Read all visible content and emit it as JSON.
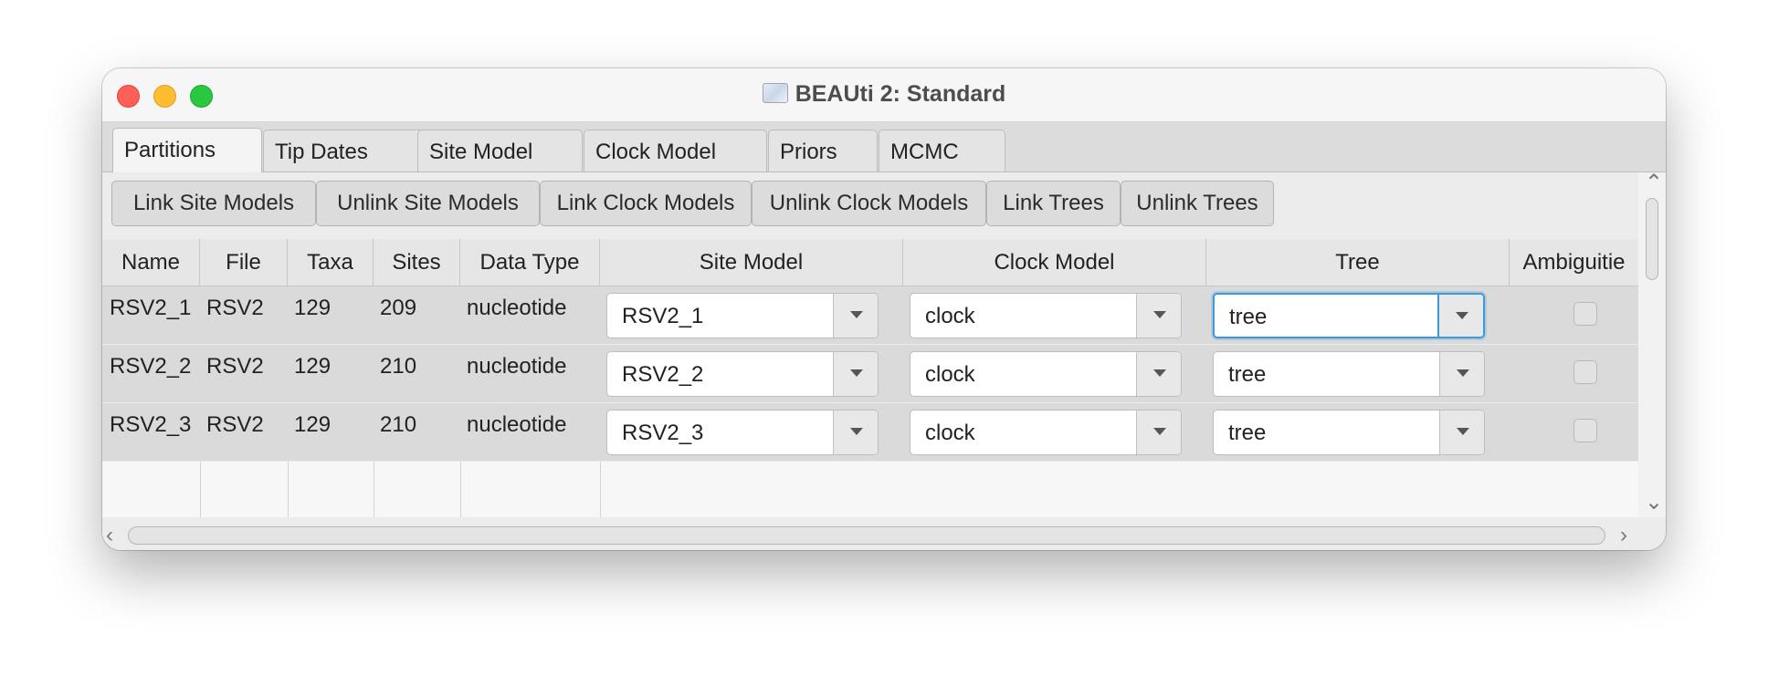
{
  "window": {
    "title": "BEAUti 2: Standard"
  },
  "tabs": [
    {
      "label": "Partitions",
      "active": true
    },
    {
      "label": "Tip Dates"
    },
    {
      "label": "Site Model"
    },
    {
      "label": "Clock Model"
    },
    {
      "label": "Priors"
    },
    {
      "label": "MCMC"
    }
  ],
  "toolbar": {
    "buttons": [
      {
        "label": "Link Site Models"
      },
      {
        "label": "Unlink Site Models"
      },
      {
        "label": "Link Clock Models"
      },
      {
        "label": "Unlink Clock Models"
      },
      {
        "label": "Link Trees"
      },
      {
        "label": "Unlink Trees"
      }
    ]
  },
  "table": {
    "columns": [
      "Name",
      "File",
      "Taxa",
      "Sites",
      "Data Type",
      "Site Model",
      "Clock Model",
      "Tree",
      "Ambiguitie"
    ],
    "rows": [
      {
        "name": "RSV2_1",
        "file": "RSV2",
        "taxa": "129",
        "sites": "209",
        "data_type": "nucleotide",
        "site_model": "RSV2_1",
        "clock_model": "clock",
        "tree": "tree",
        "ambiguities": false
      },
      {
        "name": "RSV2_2",
        "file": "RSV2",
        "taxa": "129",
        "sites": "210",
        "data_type": "nucleotide",
        "site_model": "RSV2_2",
        "clock_model": "clock",
        "tree": "tree",
        "ambiguities": false
      },
      {
        "name": "RSV2_3",
        "file": "RSV2",
        "taxa": "129",
        "sites": "210",
        "data_type": "nucleotide",
        "site_model": "RSV2_3",
        "clock_model": "clock",
        "tree": "tree",
        "ambiguities": false
      }
    ]
  },
  "icons": {
    "app": "beauti-app-icon",
    "dropdown": "chevron-down-icon",
    "scroll_up": "chevron-up-icon",
    "scroll_down": "chevron-down-icon",
    "scroll_left": "chevron-left-icon",
    "scroll_right": "chevron-right-icon"
  },
  "colors": {
    "focus": "#3b99de",
    "close": "#fe5f57",
    "minimize": "#febc2e",
    "maximize": "#28c840"
  }
}
